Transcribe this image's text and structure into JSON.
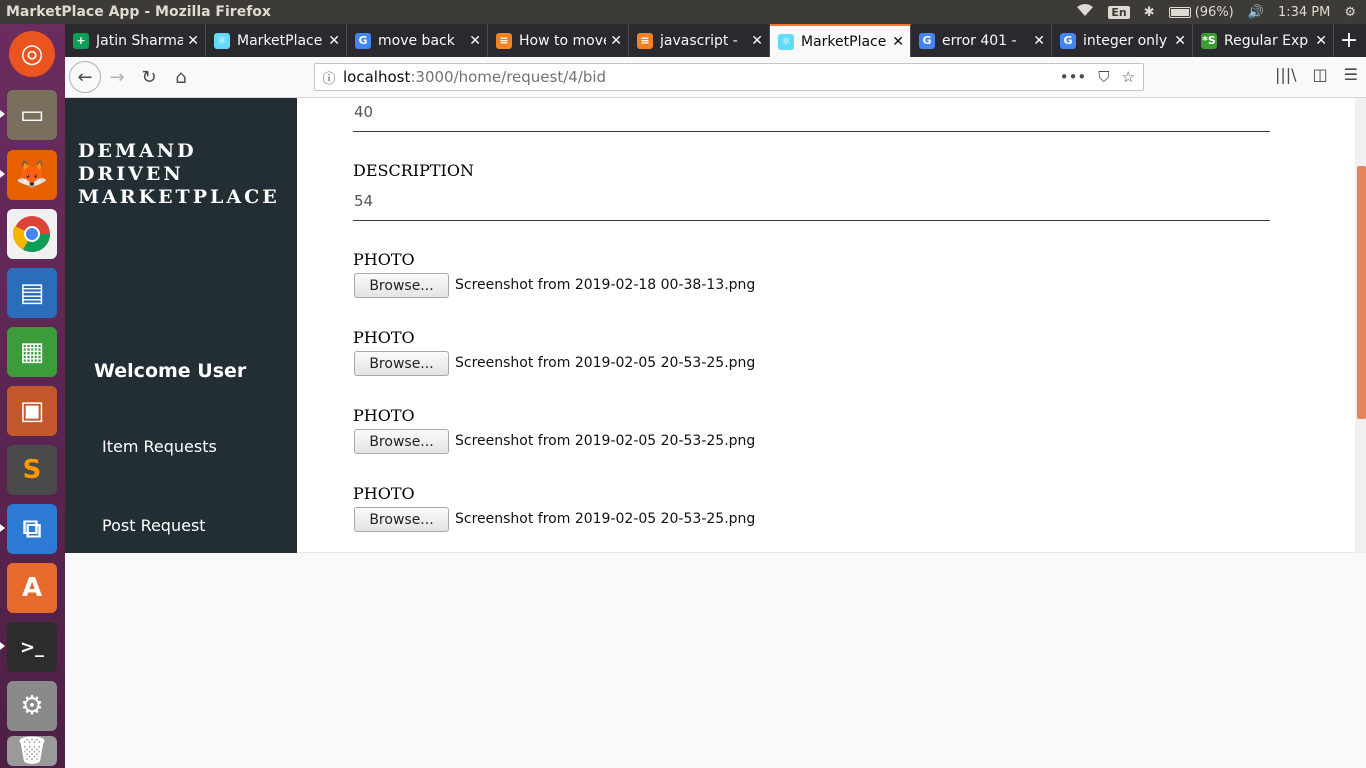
{
  "os": {
    "window_title": "MarketPlace App - Mozilla Firefox",
    "keyboard_layout": "En",
    "battery": "(96%)",
    "clock": "1:34 PM"
  },
  "browser": {
    "tabs": [
      {
        "label": "Jatin Sharma",
        "favicon_color": "#0f9d58",
        "favicon_glyph": "+"
      },
      {
        "label": "MarketPlace",
        "favicon_color": "#61dafb",
        "favicon_glyph": "⚛"
      },
      {
        "label": "move back",
        "favicon_color": "#4285f4",
        "favicon_glyph": "G"
      },
      {
        "label": "How to move",
        "favicon_color": "#f48024",
        "favicon_glyph": "≡"
      },
      {
        "label": "javascript -",
        "favicon_color": "#f48024",
        "favicon_glyph": "≡"
      },
      {
        "label": "MarketPlace",
        "favicon_color": "#61dafb",
        "favicon_glyph": "⚛",
        "active": true
      },
      {
        "label": "error 401 -",
        "favicon_color": "#4285f4",
        "favicon_glyph": "G"
      },
      {
        "label": "integer only",
        "favicon_color": "#4285f4",
        "favicon_glyph": "G"
      },
      {
        "label": "Regular Exp",
        "favicon_color": "#3d9b35",
        "favicon_glyph": "*S"
      }
    ],
    "url_host": "localhost",
    "url_path": ":3000/home/request/4/bid"
  },
  "sidebar": {
    "brand_line1": "DEMAND",
    "brand_line2": "DRIVEN",
    "brand_line3": "MARKETPLACE",
    "welcome": "Welcome User",
    "links": [
      "Item Requests",
      "Post Request"
    ]
  },
  "form": {
    "price_value": "40",
    "description_label": "DESCRIPTION",
    "description_value": "54",
    "photos": [
      {
        "label": "PHOTO",
        "button": "Browse...",
        "file": "Screenshot from 2019-02-18 00-38-13.png"
      },
      {
        "label": "PHOTO",
        "button": "Browse...",
        "file": "Screenshot from 2019-02-05 20-53-25.png"
      },
      {
        "label": "PHOTO",
        "button": "Browse...",
        "file": "Screenshot from 2019-02-05 20-53-25.png"
      },
      {
        "label": "PHOTO",
        "button": "Browse...",
        "file": "Screenshot from 2019-02-05 20-53-25.png"
      }
    ]
  },
  "colors": {
    "sidebar_bg": "#232e34",
    "scroll_thumb": "#e8845a",
    "active_tab_accent": "#ff7139"
  }
}
